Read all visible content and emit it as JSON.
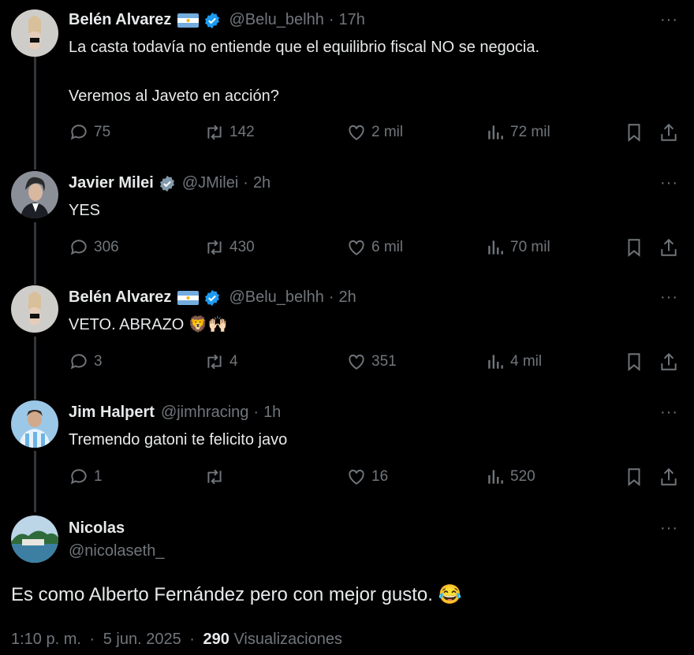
{
  "tweets": [
    {
      "name": "Belén Alvarez",
      "handle": "@Belu_belhh",
      "time": "17h",
      "text": "La casta todavía no entiende que el equilibrio fiscal NO se negocia.\n\nVeremos al Javeto en acción?",
      "replies": "75",
      "retweets": "142",
      "likes": "2 mil",
      "views": "72 mil"
    },
    {
      "name": "Javier Milei",
      "handle": "@JMilei",
      "time": "2h",
      "text": "YES",
      "replies": "306",
      "retweets": "430",
      "likes": "6 mil",
      "views": "70 mil"
    },
    {
      "name": "Belén Alvarez",
      "handle": "@Belu_belhh",
      "time": "2h",
      "text": "VETO. ABRAZO 🦁🙌🏻",
      "replies": "3",
      "retweets": "4",
      "likes": "351",
      "views": "4 mil"
    },
    {
      "name": "Jim Halpert",
      "handle": "@jimhracing",
      "time": "1h",
      "text": "Tremendo gatoni te felicito javo",
      "replies": "1",
      "retweets": "",
      "likes": "16",
      "views": "520"
    }
  ],
  "main": {
    "name": "Nicolas",
    "handle": "@nicolaseth_",
    "text": "Es como Alberto Fernández pero con mejor gusto. 😂",
    "time": "1:10 p. m.",
    "date": "5 jun. 2025",
    "views_count": "290",
    "views_label": "Visualizaciones"
  },
  "separator": "·",
  "more_label": "···",
  "colors": {
    "background": "#000000",
    "text": "#e7e9ea",
    "muted": "#71767b",
    "verified": "#1d9bf0"
  },
  "icons": [
    "reply-icon",
    "retweet-icon",
    "like-icon",
    "views-icon",
    "bookmark-icon",
    "share-icon",
    "verified-icon",
    "argentina-flag-icon",
    "more-icon"
  ]
}
